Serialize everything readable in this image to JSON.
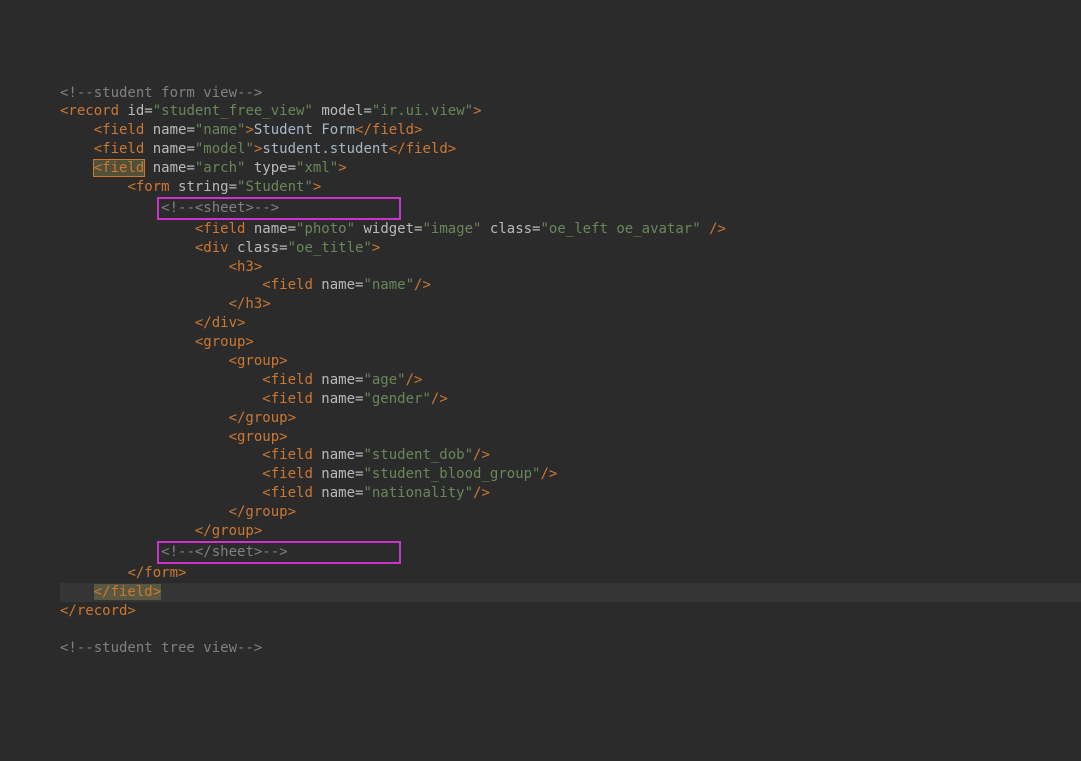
{
  "comments": {
    "form_view": "<!--student form view-->",
    "sheet_open": "<!--<sheet>-->",
    "sheet_close": "<!--</sheet>-->",
    "tree_view": "<!--student tree view-->"
  },
  "record": {
    "open_lt": "<record",
    "id_attr": " id=",
    "id_val": "\"student_free_view\"",
    "model_attr": " model=",
    "model_val": "\"ir.ui.view\"",
    "open_gt": ">",
    "close": "</record>"
  },
  "field_name": {
    "open_lt": "<field",
    "name_attr": " name=",
    "name_val": "\"name\"",
    "open_gt": ">",
    "text": "Student Form",
    "close": "</field>"
  },
  "field_model": {
    "open_lt": "<field",
    "name_attr": " name=",
    "name_val": "\"model\"",
    "open_gt": ">",
    "text": "student.student",
    "close": "</field>"
  },
  "field_arch": {
    "open_lt": "<field",
    "name_attr": " name=",
    "name_val": "\"arch\"",
    "type_attr": " type=",
    "type_val": "\"xml\"",
    "open_gt": ">",
    "close": "</field>"
  },
  "form": {
    "open_lt": "<form",
    "string_attr": " string=",
    "string_val": "\"Student\"",
    "open_gt": ">",
    "close": "</form>"
  },
  "field_photo": {
    "open_lt": "<field",
    "name_attr": " name=",
    "name_val": "\"photo\"",
    "widget_attr": " widget=",
    "widget_val": "\"image\"",
    "class_attr": " class=",
    "class_val": "\"oe_left oe_avatar\"",
    "selfclose": " />"
  },
  "div_title": {
    "open_lt": "<div",
    "class_attr": " class=",
    "class_val": "\"oe_title\"",
    "open_gt": ">",
    "close": "</div>"
  },
  "h3": {
    "open": "<h3>",
    "close": "</h3>"
  },
  "field_innername": {
    "open_lt": "<field",
    "name_attr": " name=",
    "name_val": "\"name\"",
    "selfclose": "/>"
  },
  "group": {
    "open": "<group>",
    "close": "</group>"
  },
  "field_age": {
    "open_lt": "<field",
    "name_attr": " name=",
    "name_val": "\"age\"",
    "selfclose": "/>"
  },
  "field_gender": {
    "open_lt": "<field",
    "name_attr": " name=",
    "name_val": "\"gender\"",
    "selfclose": "/>"
  },
  "field_dob": {
    "open_lt": "<field",
    "name_attr": " name=",
    "name_val": "\"student_dob\"",
    "selfclose": "/>"
  },
  "field_blood": {
    "open_lt": "<field",
    "name_attr": " name=",
    "name_val": "\"student_blood_group\"",
    "selfclose": "/>"
  },
  "field_nat": {
    "open_lt": "<field",
    "name_attr": " name=",
    "name_val": "\"nationality\"",
    "selfclose": "/>"
  }
}
